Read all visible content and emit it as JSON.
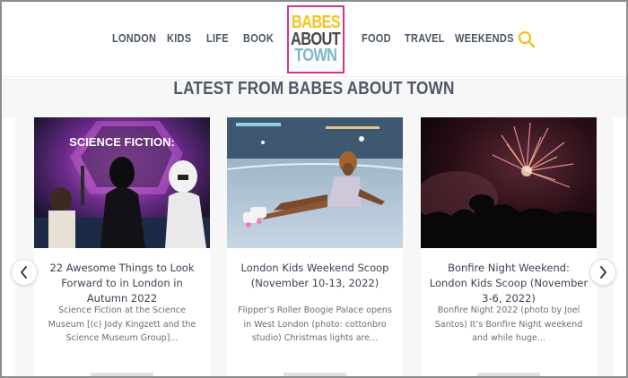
{
  "nav": {
    "left": [
      "LONDON",
      "KIDS",
      "LIFE",
      "BOOK"
    ],
    "right": [
      "FOOD",
      "TRAVEL",
      "WEEKENDS"
    ]
  },
  "logo": {
    "line1": "BABES",
    "line2": "ABOUT",
    "line3": "TOWN"
  },
  "colors": {
    "logo_border": "#d63384",
    "logo_yellow": "#f2c51d",
    "logo_grey": "#474747",
    "logo_teal": "#7ab9c5",
    "search_icon": "#f0c419",
    "nav_text": "#4b5565"
  },
  "section": {
    "title": "LATEST FROM BABES ABOUT TOWN"
  },
  "cards": [
    {
      "title": "22 Awesome Things to Look Forward to in London in Autumn 2022",
      "excerpt": "Science Fiction at the Science Museum [(c) Jody Kingzett and the Science Museum Group]...",
      "image": "science-fiction-exhibition-photo",
      "image_text": "SCIENCE FICTION:"
    },
    {
      "title": "London Kids Weekend Scoop (November 10-13, 2022)",
      "excerpt": "Flipper’s Roller Boogie Palace opens in West London (photo: cottonbro studio) Christmas lights are...",
      "image": "roller-skater-photo"
    },
    {
      "title": "Bonfire Night Weekend: London Kids Scoop (November 3-6, 2022)",
      "excerpt": "Bonfire Night 2022 (photo by Joel Santos) It’s Bonfire Night weekend and while huge...",
      "image": "fireworks-photo"
    }
  ],
  "icons": {
    "search": "search-icon",
    "prev": "chevron-left-icon",
    "next": "chevron-right-icon"
  }
}
